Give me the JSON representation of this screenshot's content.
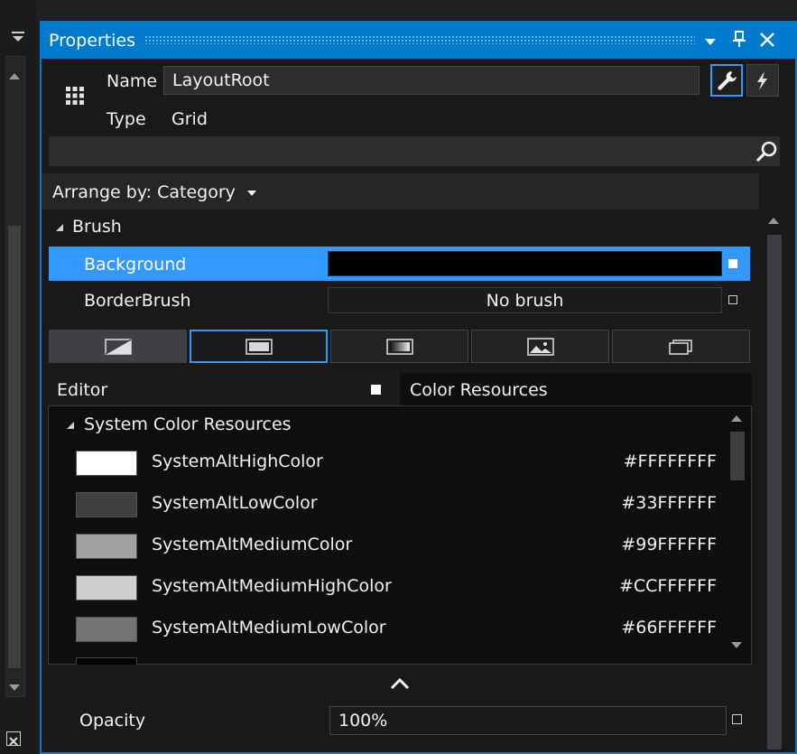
{
  "window": {
    "title": "Properties",
    "icons": [
      "dropdown-arrow-icon",
      "pin-icon",
      "close-icon"
    ]
  },
  "header": {
    "name_label": "Name",
    "name_value": "LayoutRoot",
    "type_label": "Type",
    "type_value": "Grid",
    "icons": [
      "grid-icon",
      "wrench-icon",
      "lightning-icon",
      "search-icon"
    ]
  },
  "arrange": {
    "label": "Arrange by: Category",
    "icon": "caret-down-icon"
  },
  "brush": {
    "category": "Brush",
    "background_label": "Background",
    "background_color": "#000000",
    "borderbrush_label": "BorderBrush",
    "borderbrush_value": "No brush",
    "tabs": [
      "null-brush-icon",
      "solid-brush-icon",
      "gradient-brush-icon",
      "image-brush-icon",
      "brush-resources-icon"
    ],
    "selected_tab": "solid-brush-icon"
  },
  "editor_tabs": {
    "editor_label": "Editor",
    "resources_label": "Color Resources"
  },
  "color_resources": {
    "group": "System Color Resources",
    "items": [
      {
        "name": "SystemAltHighColor",
        "hex": "#FFFFFFFF",
        "swatch": "#ffffff"
      },
      {
        "name": "SystemAltLowColor",
        "hex": "#33FFFFFF",
        "swatch": "#404040"
      },
      {
        "name": "SystemAltMediumColor",
        "hex": "#99FFFFFF",
        "swatch": "#a0a0a0"
      },
      {
        "name": "SystemAltMediumHighColor",
        "hex": "#CCFFFFFF",
        "swatch": "#cfcfcf"
      },
      {
        "name": "SystemAltMediumLowColor",
        "hex": "#66FFFFFF",
        "swatch": "#737373"
      }
    ]
  },
  "opacity": {
    "label": "Opacity",
    "value": "100%"
  },
  "colors": {
    "accent": "#007acc",
    "selection": "#3399ff",
    "panel_bg": "#19191a"
  }
}
